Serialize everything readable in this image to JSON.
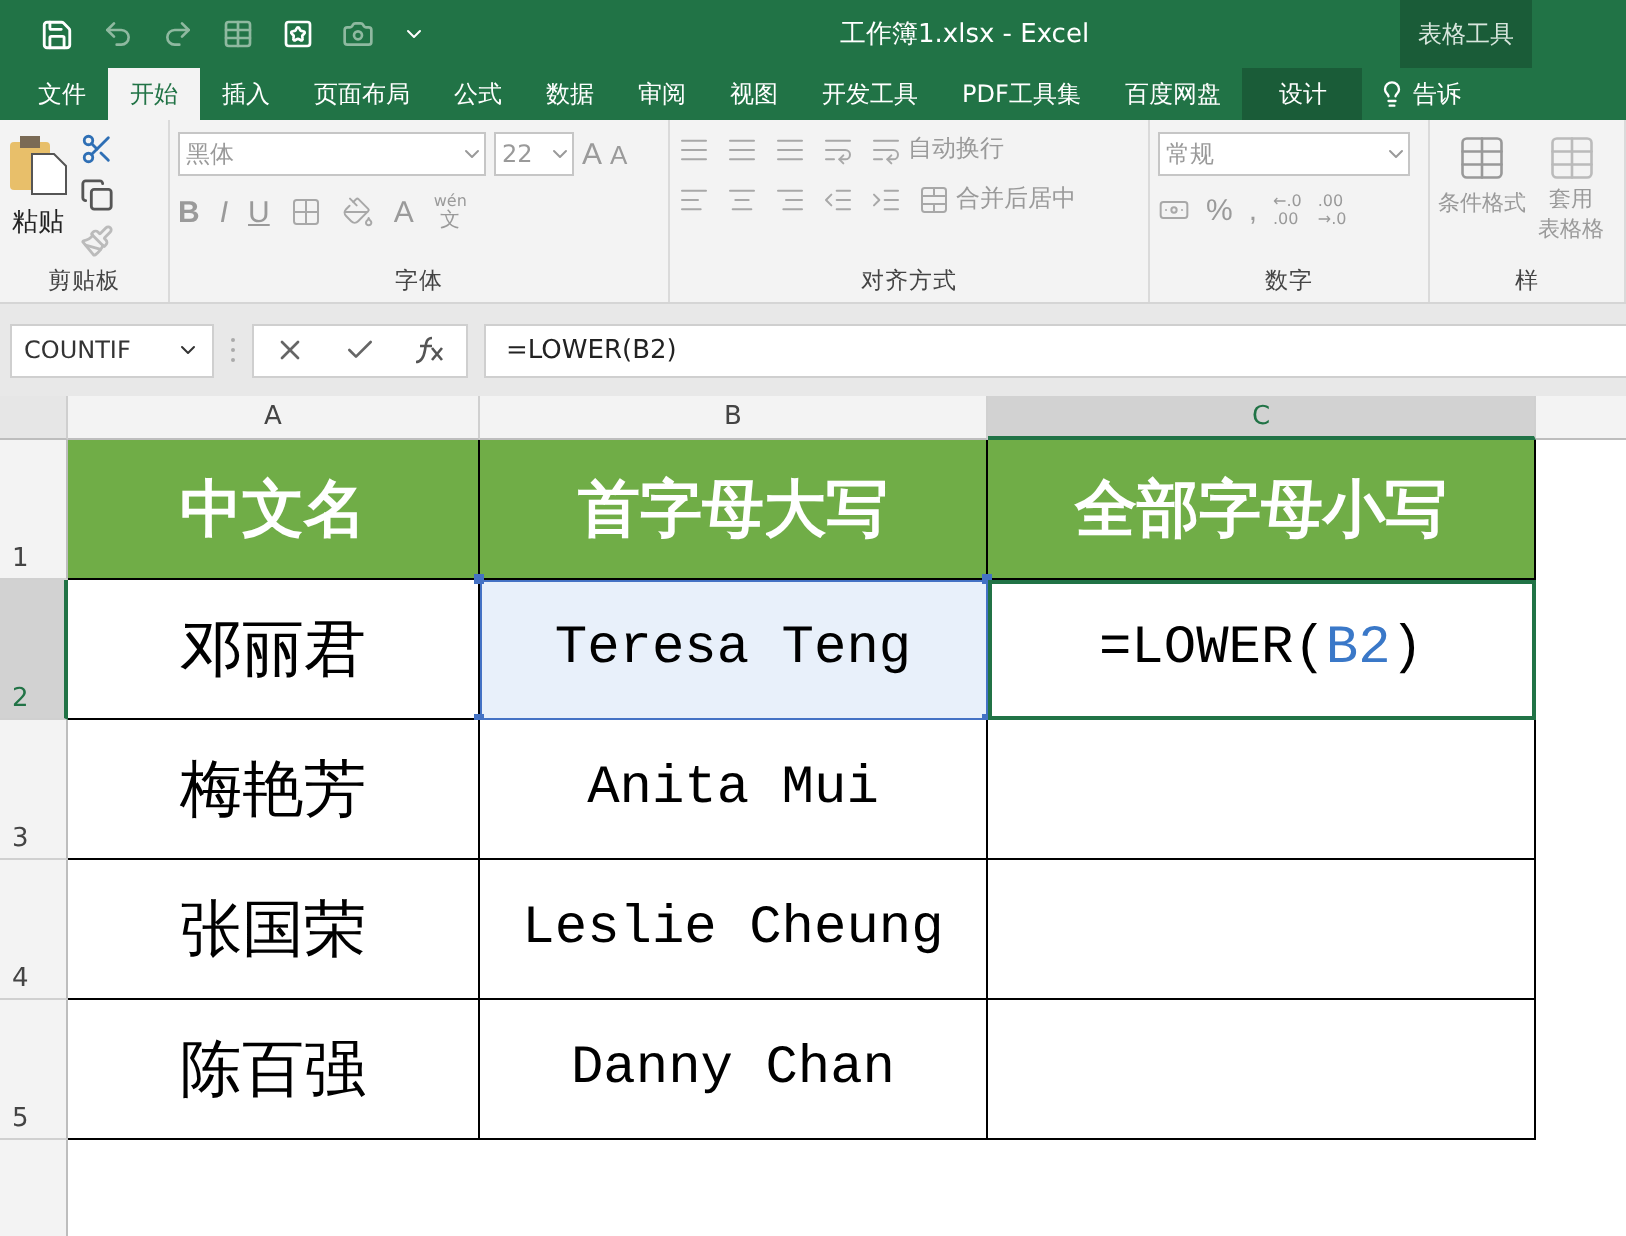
{
  "title_bar": {
    "title": "工作簿1.xlsx - Excel",
    "context_label": "表格工具"
  },
  "tabs": [
    {
      "label": "文件",
      "selected": false,
      "kind": "normal"
    },
    {
      "label": "开始",
      "selected": true,
      "kind": "normal"
    },
    {
      "label": "插入",
      "selected": false,
      "kind": "normal"
    },
    {
      "label": "页面布局",
      "selected": false,
      "kind": "normal"
    },
    {
      "label": "公式",
      "selected": false,
      "kind": "normal"
    },
    {
      "label": "数据",
      "selected": false,
      "kind": "normal"
    },
    {
      "label": "审阅",
      "selected": false,
      "kind": "normal"
    },
    {
      "label": "视图",
      "selected": false,
      "kind": "normal"
    },
    {
      "label": "开发工具",
      "selected": false,
      "kind": "normal"
    },
    {
      "label": "PDF工具集",
      "selected": false,
      "kind": "normal"
    },
    {
      "label": "百度网盘",
      "selected": false,
      "kind": "normal"
    },
    {
      "label": "设计",
      "selected": false,
      "kind": "context"
    }
  ],
  "tell_me": "告诉",
  "ribbon": {
    "clipboard": {
      "paste": "粘贴",
      "label": "剪贴板"
    },
    "font": {
      "font_name": "黑体",
      "font_size": "22",
      "grow": "A",
      "shrink": "A",
      "bold": "B",
      "italic": "I",
      "underline": "U",
      "font_color": "A",
      "phonetic_top": "wén",
      "phonetic_bottom": "文",
      "label": "字体"
    },
    "alignment": {
      "wrap": "自动换行",
      "merge": "合并后居中",
      "label": "对齐方式"
    },
    "number": {
      "format": "常规",
      "percent": "%",
      "comma": ",",
      "increase_decimal": [
        "←.0",
        ".00"
      ],
      "decrease_decimal": [
        ".00",
        "→.0"
      ],
      "label": "数字"
    },
    "styles": {
      "conditional": "条件格式",
      "table_format": [
        "套用",
        "表格格"
      ],
      "label": "样"
    }
  },
  "formula_bar": {
    "name_box": "COUNTIF",
    "formula": "=LOWER(B2)"
  },
  "columns": [
    {
      "label": "A",
      "selected": false
    },
    {
      "label": "B",
      "selected": false
    },
    {
      "label": "C",
      "selected": true
    }
  ],
  "rows": [
    {
      "number": "1",
      "selected": false,
      "cells": [
        {
          "kind": "header",
          "text": "中文名"
        },
        {
          "kind": "header",
          "text": "首字母大写"
        },
        {
          "kind": "header",
          "text": "全部字母小写"
        }
      ]
    },
    {
      "number": "2",
      "selected": true,
      "cells": [
        {
          "kind": "chinese",
          "text": "邓丽君"
        },
        {
          "kind": "latin",
          "text": "Teresa Teng",
          "referenced": true
        },
        {
          "kind": "formula",
          "active": true,
          "parts": [
            {
              "kind": "plain",
              "text": "=LOWER("
            },
            {
              "kind": "ref",
              "text": "B2"
            },
            {
              "kind": "plain",
              "text": ")"
            }
          ]
        }
      ]
    },
    {
      "number": "3",
      "selected": false,
      "cells": [
        {
          "kind": "chinese",
          "text": "梅艳芳"
        },
        {
          "kind": "latin",
          "text": "Anita Mui"
        },
        {
          "kind": "empty"
        }
      ]
    },
    {
      "number": "4",
      "selected": false,
      "cells": [
        {
          "kind": "chinese",
          "text": "张国荣"
        },
        {
          "kind": "latin",
          "text": "Leslie Cheung"
        },
        {
          "kind": "empty"
        }
      ]
    },
    {
      "number": "5",
      "selected": false,
      "cells": [
        {
          "kind": "chinese",
          "text": "陈百强"
        },
        {
          "kind": "latin",
          "text": "Danny Chan"
        },
        {
          "kind": "empty"
        }
      ]
    }
  ]
}
